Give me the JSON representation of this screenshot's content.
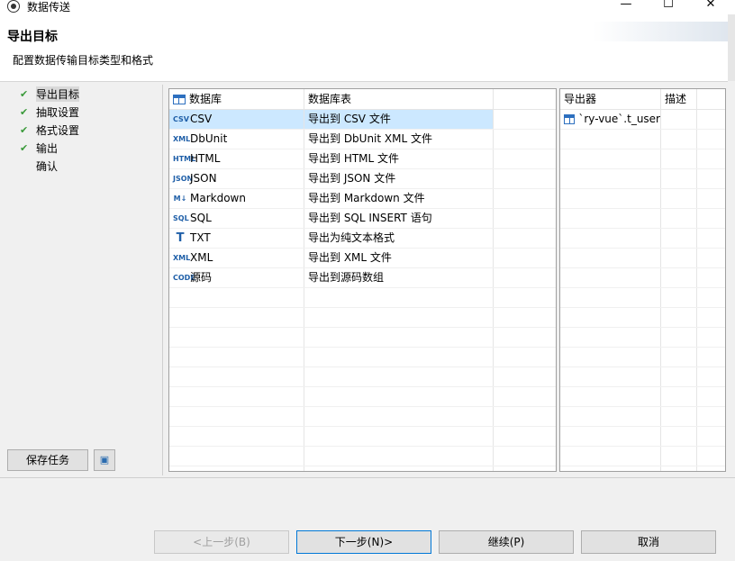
{
  "window": {
    "title": "数据传送",
    "controls": {
      "minimize": "—",
      "maximize": "☐",
      "close": "✕"
    }
  },
  "header": {
    "title": "导出目标",
    "subtitle": "配置数据传输目标类型和格式"
  },
  "steps": [
    {
      "label": "导出目标",
      "done": true,
      "selected": true
    },
    {
      "label": "抽取设置",
      "done": true
    },
    {
      "label": "格式设置",
      "done": true
    },
    {
      "label": "输出",
      "done": true
    },
    {
      "label": "确认",
      "done": false
    }
  ],
  "left_buttons": {
    "save_task": "保存任务",
    "task_icon": "task-icon"
  },
  "format_table": {
    "headers": [
      "数据库",
      "数据库表"
    ],
    "rows": [
      {
        "name": "CSV",
        "desc": "导出到 CSV 文件",
        "icon": "CSV",
        "selected": true
      },
      {
        "name": "DbUnit",
        "desc": "导出到 DbUnit XML 文件",
        "icon": "XML"
      },
      {
        "name": "HTML",
        "desc": "导出到 HTML 文件",
        "icon": "HTML"
      },
      {
        "name": "JSON",
        "desc": "导出到 JSON 文件",
        "icon": "JSON"
      },
      {
        "name": "Markdown",
        "desc": "导出到 Markdown 文件",
        "icon": "M↓"
      },
      {
        "name": "SQL",
        "desc": "导出到 SQL INSERT 语句",
        "icon": "SQL"
      },
      {
        "name": "TXT",
        "desc": "导出为纯文本格式",
        "icon": "T"
      },
      {
        "name": "XML",
        "desc": "导出到 XML 文件",
        "icon": "XML"
      },
      {
        "name": "源码",
        "desc": "导出到源码数组",
        "icon": "CODE"
      }
    ]
  },
  "exporter_table": {
    "headers": [
      "导出器",
      "描述"
    ],
    "rows": [
      {
        "name": "`ry-vue`.t_user",
        "desc": ""
      }
    ]
  },
  "footer": {
    "back": "<上一步(B)",
    "next": "下一步(N)>",
    "continue": "继续(P)",
    "cancel": "取消"
  }
}
